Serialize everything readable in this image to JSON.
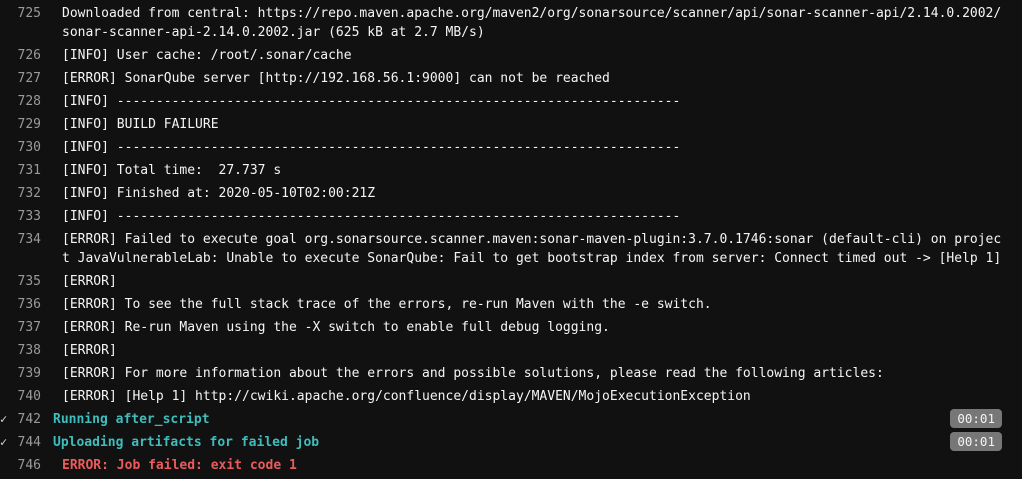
{
  "lines": [
    {
      "num": "725",
      "text": "Downloaded from central: https://repo.maven.apache.org/maven2/org/sonarsource/scanner/api/sonar-scanner-api/2.14.0.2002/sonar-scanner-api-2.14.0.2002.jar (625 kB at 2.7 MB/s)"
    },
    {
      "num": "726",
      "text": "[INFO] User cache: /root/.sonar/cache"
    },
    {
      "num": "727",
      "text": "[ERROR] SonarQube server [http://192.168.56.1:9000] can not be reached"
    },
    {
      "num": "728",
      "text": "[INFO] ------------------------------------------------------------------------"
    },
    {
      "num": "729",
      "text": "[INFO] BUILD FAILURE"
    },
    {
      "num": "730",
      "text": "[INFO] ------------------------------------------------------------------------"
    },
    {
      "num": "731",
      "text": "[INFO] Total time:  27.737 s"
    },
    {
      "num": "732",
      "text": "[INFO] Finished at: 2020-05-10T02:00:21Z"
    },
    {
      "num": "733",
      "text": "[INFO] ------------------------------------------------------------------------"
    },
    {
      "num": "734",
      "text": "[ERROR] Failed to execute goal org.sonarsource.scanner.maven:sonar-maven-plugin:3.7.0.1746:sonar (default-cli) on project JavaVulnerableLab: Unable to execute SonarQube: Fail to get bootstrap index from server: Connect timed out -> [Help 1]"
    },
    {
      "num": "735",
      "text": "[ERROR]"
    },
    {
      "num": "736",
      "text": "[ERROR] To see the full stack trace of the errors, re-run Maven with the -e switch."
    },
    {
      "num": "737",
      "text": "[ERROR] Re-run Maven using the -X switch to enable full debug logging."
    },
    {
      "num": "738",
      "text": "[ERROR]"
    },
    {
      "num": "739",
      "text": "[ERROR] For more information about the errors and possible solutions, please read the following articles:"
    },
    {
      "num": "740",
      "text": "[ERROR] [Help 1] http://cwiki.apache.org/confluence/display/MAVEN/MojoExecutionException"
    }
  ],
  "sections": [
    {
      "num": "742",
      "text": "Running after_script",
      "duration": "00:01"
    },
    {
      "num": "744",
      "text": "Uploading artifacts for failed job",
      "duration": "00:01"
    }
  ],
  "final": {
    "num": "746",
    "text": "ERROR: Job failed: exit code 1"
  },
  "colors": {
    "section": "#3fbdbd",
    "error": "#ec5b5b",
    "badge": "#777777"
  },
  "icons": {
    "section_toggle": "chevron-collapse-icon"
  }
}
